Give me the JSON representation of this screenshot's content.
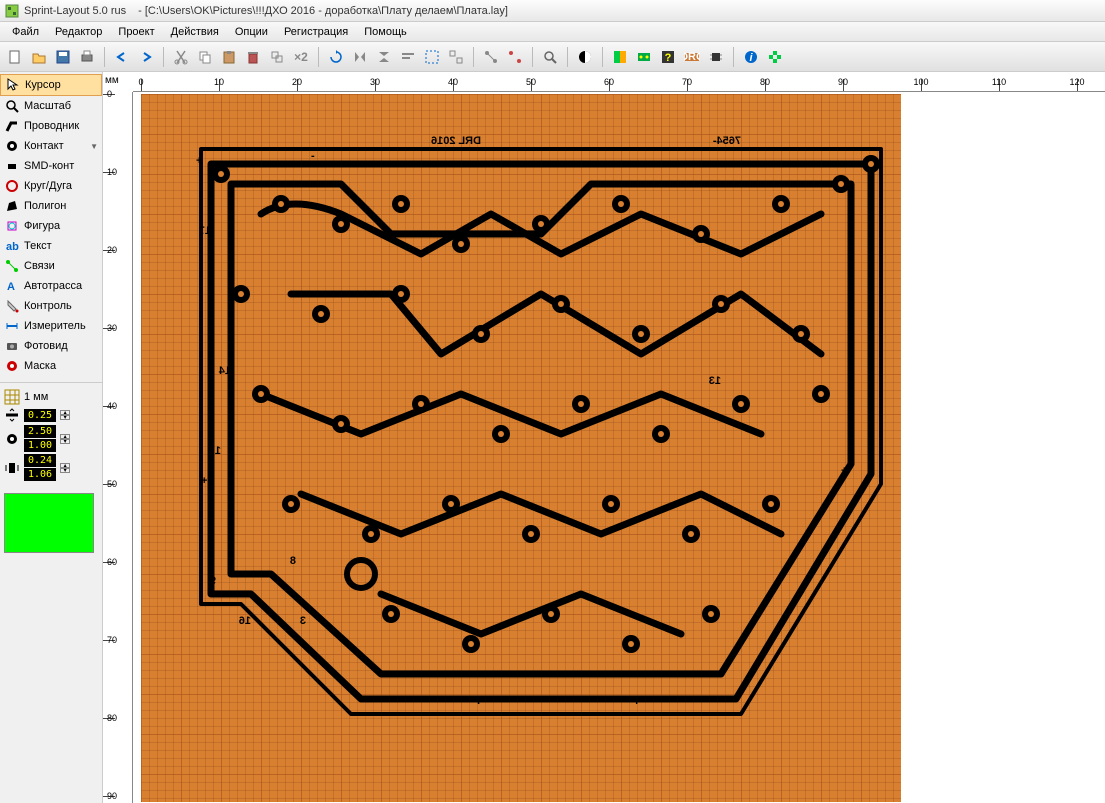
{
  "titlebar": {
    "app_name": "Sprint-Layout 5.0 rus",
    "file_path": "- [C:\\Users\\OK\\Pictures\\!!!ДХО 2016 - доработка\\Плату делаем\\Плата.lay]"
  },
  "menu": [
    "Файл",
    "Редактор",
    "Проект",
    "Действия",
    "Опции",
    "Регистрация",
    "Помощь"
  ],
  "tools": [
    {
      "id": "cursor",
      "label": "Курсор",
      "active": true
    },
    {
      "id": "zoom",
      "label": "Масштаб"
    },
    {
      "id": "track",
      "label": "Проводник"
    },
    {
      "id": "pad",
      "label": "Контакт",
      "arrow": true
    },
    {
      "id": "smd",
      "label": "SMD-конт"
    },
    {
      "id": "circle",
      "label": "Круг/Дуга"
    },
    {
      "id": "polygon",
      "label": "Полигон"
    },
    {
      "id": "special",
      "label": "Фигура"
    },
    {
      "id": "text",
      "label": "Текст"
    },
    {
      "id": "connect",
      "label": "Связи"
    },
    {
      "id": "autoroute",
      "label": "Автотрасса"
    },
    {
      "id": "test",
      "label": "Контроль"
    },
    {
      "id": "measure",
      "label": "Измеритель"
    },
    {
      "id": "photoview",
      "label": "Фотовид"
    },
    {
      "id": "mask",
      "label": "Маска"
    }
  ],
  "props": {
    "grid": "1 мм",
    "track_width": "0.25",
    "pad_outer": "2.50",
    "pad_inner": "1.00",
    "size1": "0.24",
    "size2": "1.06"
  },
  "ruler": {
    "unit": "мм",
    "h_ticks": [
      0,
      10,
      20,
      30,
      40,
      50,
      60,
      70,
      80,
      90,
      100,
      110,
      120
    ],
    "v_ticks": [
      0,
      10,
      20,
      30,
      40,
      50,
      60,
      70,
      80,
      90
    ]
  },
  "pcb": {
    "title_text": "DRL 2016",
    "marker_text": "7654-",
    "labels": [
      "17",
      "14",
      "10",
      "9",
      "16",
      "8",
      "3",
      "7",
      "4",
      "13"
    ],
    "polarity": [
      "+",
      "-",
      "+",
      "+"
    ]
  },
  "toolbar_x2": "×2"
}
